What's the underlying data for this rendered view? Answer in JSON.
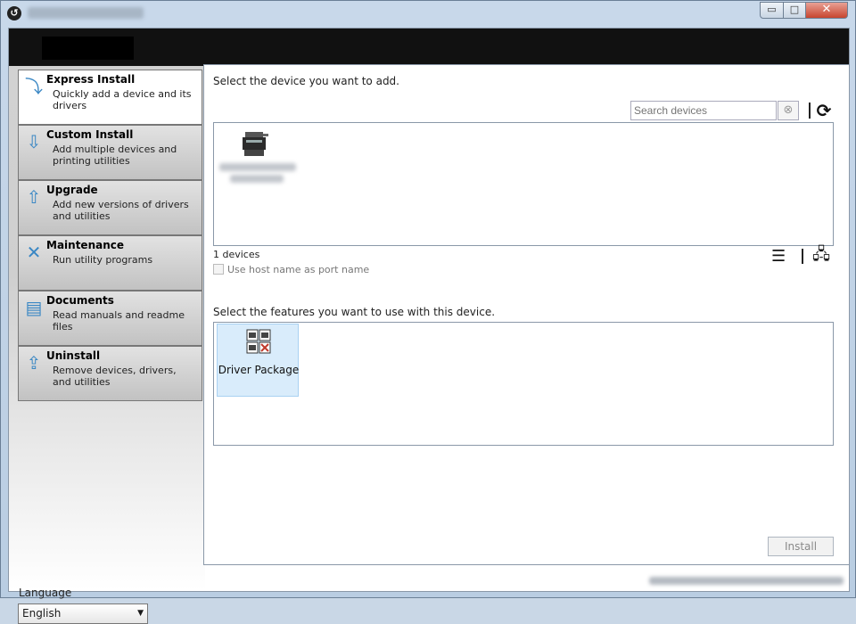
{
  "window": {
    "app_icon": "back-arrow-circle-icon",
    "controls": {
      "minimize": "▭",
      "maximize": "□",
      "close": "✕"
    }
  },
  "nav": [
    {
      "title": "Express Install",
      "desc": "Quickly add a device and its drivers",
      "icon": "⤵",
      "active": true
    },
    {
      "title": "Custom Install",
      "desc": "Add multiple devices and printing utilities",
      "icon": "⇩"
    },
    {
      "title": "Upgrade",
      "desc": "Add new versions of drivers and utilities",
      "icon": "⇧"
    },
    {
      "title": "Maintenance",
      "desc": "Run utility programs",
      "icon": "✕"
    },
    {
      "title": "Documents",
      "desc": "Read manuals and readme files",
      "icon": "▤"
    },
    {
      "title": "Uninstall",
      "desc": "Remove devices, drivers, and utilities",
      "icon": "⇪"
    }
  ],
  "language": {
    "label": "Language",
    "value": "English"
  },
  "main": {
    "select_device_label": "Select the device you want to add.",
    "search_placeholder": "Search devices",
    "devices_count": "1 devices",
    "host_name_label": "Use host name as port name",
    "select_features_label": "Select the features you want to use with this device.",
    "feature_name": "Driver Package",
    "install_label": "Install"
  },
  "colors": {
    "banner": "#111111",
    "feature_bg": "#d9ecfb",
    "nav_icon": "#3a87c4"
  }
}
